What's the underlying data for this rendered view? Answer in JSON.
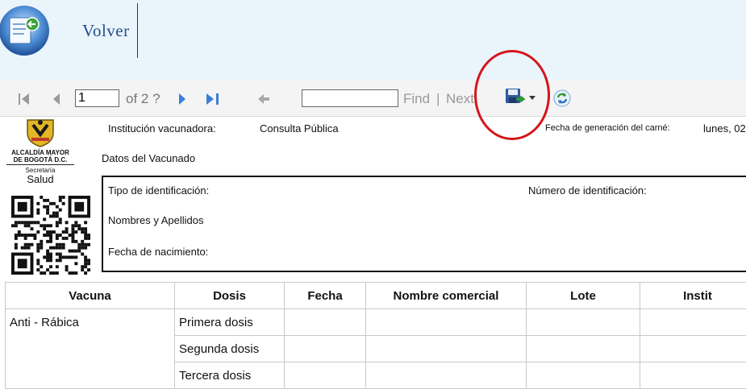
{
  "header": {
    "back_label": "Volver"
  },
  "toolbar": {
    "page_value": "1",
    "of_label": "of 2 ?",
    "find_label": "Find",
    "separator": "|",
    "next_label": "Next"
  },
  "report": {
    "alcaldia": "ALCALDÍA MAYOR",
    "bogota": "DE BOGOTÁ D.C.",
    "secretaria": "Secretaría",
    "salud": "Salud",
    "institucion_label": "Institución vacunadora:",
    "institucion_value": "Consulta Pública",
    "fecha_gen_label": "Fecha de generación del carné:",
    "fecha_gen_value": "lunes, 02",
    "datos_label": "Datos del Vacunado",
    "tipo_id_label": "Tipo de identificación:",
    "numero_id_label": "Número de identificación:",
    "nombres_label": "Nombres y Apellidos",
    "nacimiento_label": "Fecha de nacimiento:"
  },
  "table": {
    "headers": [
      "Vacuna",
      "Dosis",
      "Fecha",
      "Nombre comercial",
      "Lote",
      "Instit"
    ],
    "rows": [
      [
        "Anti - Rábica",
        "Primera dosis",
        "",
        "",
        "",
        ""
      ],
      [
        "",
        "Segunda dosis",
        "",
        "",
        "",
        ""
      ],
      [
        "",
        "Tercera dosis",
        "",
        "",
        "",
        ""
      ]
    ]
  }
}
